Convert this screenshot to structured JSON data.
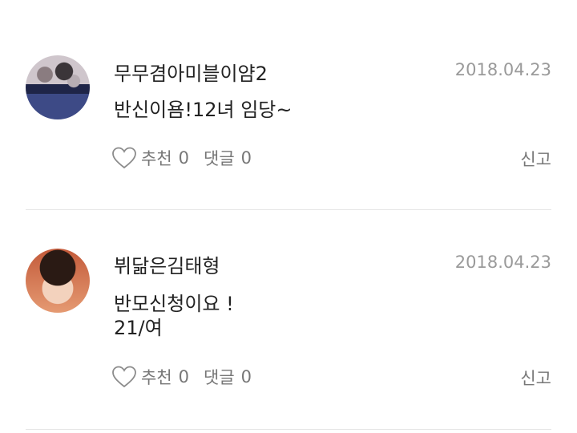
{
  "comments": [
    {
      "author": "무무겸아미블이얌2",
      "date": "2018.04.23",
      "body": [
        "반신이욤!12녀 임당~"
      ],
      "like_label": "추천",
      "like_count": "0",
      "reply_label": "댓글",
      "reply_count": "0",
      "report_label": "신고"
    },
    {
      "author": "뷔닮은김태형",
      "date": "2018.04.23",
      "body": [
        "반모신청이요 !",
        "21/여"
      ],
      "like_label": "추천",
      "like_count": "0",
      "reply_label": "댓글",
      "reply_count": "0",
      "report_label": "신고"
    }
  ],
  "icons": {
    "like": "heart-outline-icon"
  },
  "colors": {
    "text": "#222222",
    "muted": "#777777",
    "date": "#9a9a9a",
    "divider": "#e6e6e6"
  }
}
